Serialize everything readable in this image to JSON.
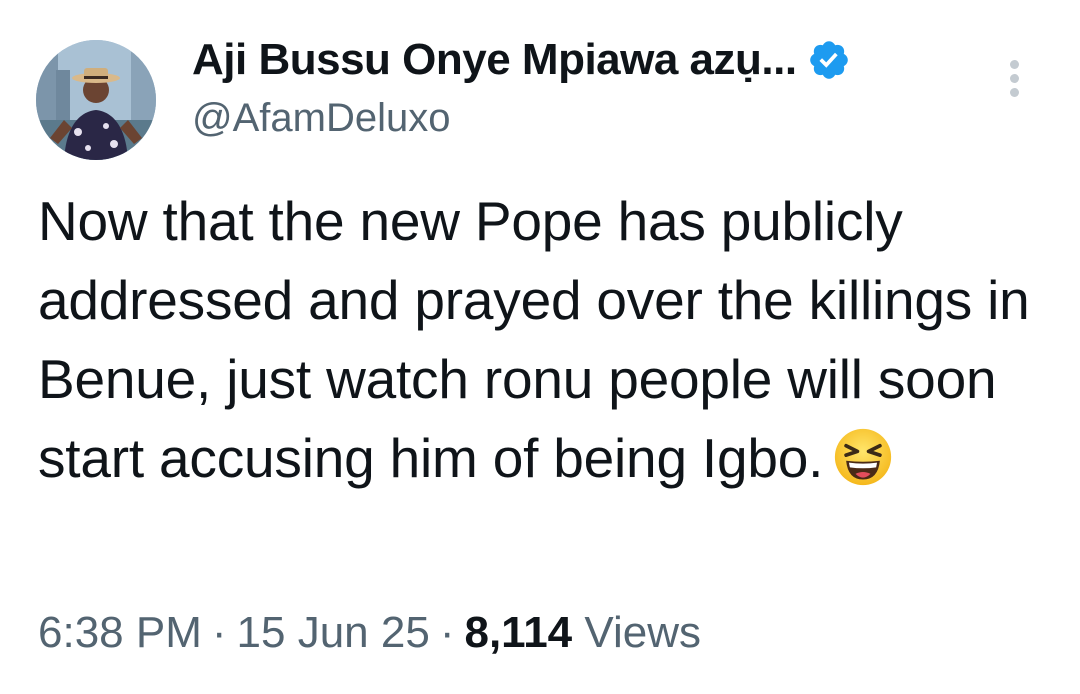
{
  "author": {
    "display_name": "Aji Bussu Onye Mpiawa azụ...",
    "handle": "@AfamDeluxo",
    "verified": true
  },
  "tweet": {
    "text": "Now that the new Pope has publicly addressed and prayed over the killings in Benue, just watch ronu people will soon start accusing him of being Igbo.",
    "emoji": "laughing-squinting-face"
  },
  "meta": {
    "time": "6:38 PM",
    "separator": "·",
    "date": "15 Jun 25",
    "views_count": "8,114",
    "views_label": "Views"
  },
  "colors": {
    "verified_badge": "#1d9bf0",
    "secondary_text": "#536471",
    "primary_text": "#0f1419"
  }
}
